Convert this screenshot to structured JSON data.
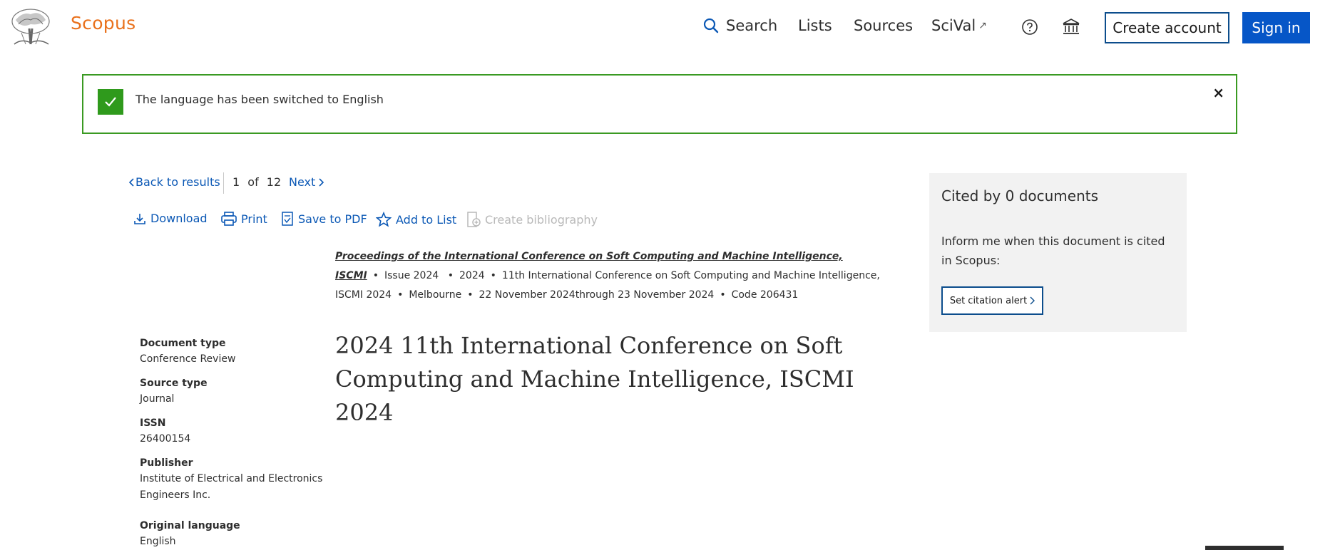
{
  "header": {
    "brand": "Scopus",
    "nav": {
      "search": "Search",
      "lists": "Lists",
      "sources": "Sources",
      "scival": "SciVal",
      "scival_ext_icon": "↗"
    },
    "create_account": "Create account",
    "sign_in": "Sign in"
  },
  "alert": {
    "message": "The language has been switched to English",
    "close": "×"
  },
  "result_nav": {
    "back": "Back to results",
    "current": "1",
    "of": "of",
    "total": "12",
    "next": "Next"
  },
  "toolbar": {
    "download": "Download",
    "print": "Print",
    "save_pdf": "Save to PDF",
    "add_to_list": "Add to List",
    "create_bibliography": "Create bibliography"
  },
  "source": {
    "journal": "Proceedings of the International Conference on Soft Computing and Machine Intelligence, ISCMI",
    "issue": "Issue 2024",
    "year": "2024",
    "conference": "11th International Conference on Soft Computing and Machine Intelligence, ISCMI 2024",
    "location": "Melbourne",
    "dates": "22 November 2024through 23 November 2024",
    "code": "Code 206431",
    "separator": "•"
  },
  "document": {
    "title": "2024 11th International Conference on Soft Computing and Machine Intelligence, ISCMI 2024"
  },
  "metadata": {
    "document_type_label": "Document type",
    "document_type": "Conference Review",
    "source_type_label": "Source type",
    "source_type": "Journal",
    "issn_label": "ISSN",
    "issn": "26400154",
    "publisher_label": "Publisher",
    "publisher": "Institute of Electrical and Electronics Engineers Inc.",
    "language_label": "Original language",
    "language": "English"
  },
  "cited": {
    "title": "Cited by 0 documents",
    "text": "Inform me when this document is cited in Scopus:",
    "button": "Set citation alert"
  },
  "colors": {
    "brand": "#e9711c",
    "link": "#0b58b5",
    "primary_button": "#0656c7",
    "success": "#2f9a1c"
  },
  "icons": [
    "elsevier-tree-logo",
    "search-icon",
    "external-link-icon",
    "help-icon",
    "institution-icon",
    "check-icon",
    "close-icon",
    "chevron-left-icon",
    "chevron-right-icon",
    "download-icon",
    "print-icon",
    "pdf-icon",
    "star-icon",
    "bibliography-icon"
  ]
}
